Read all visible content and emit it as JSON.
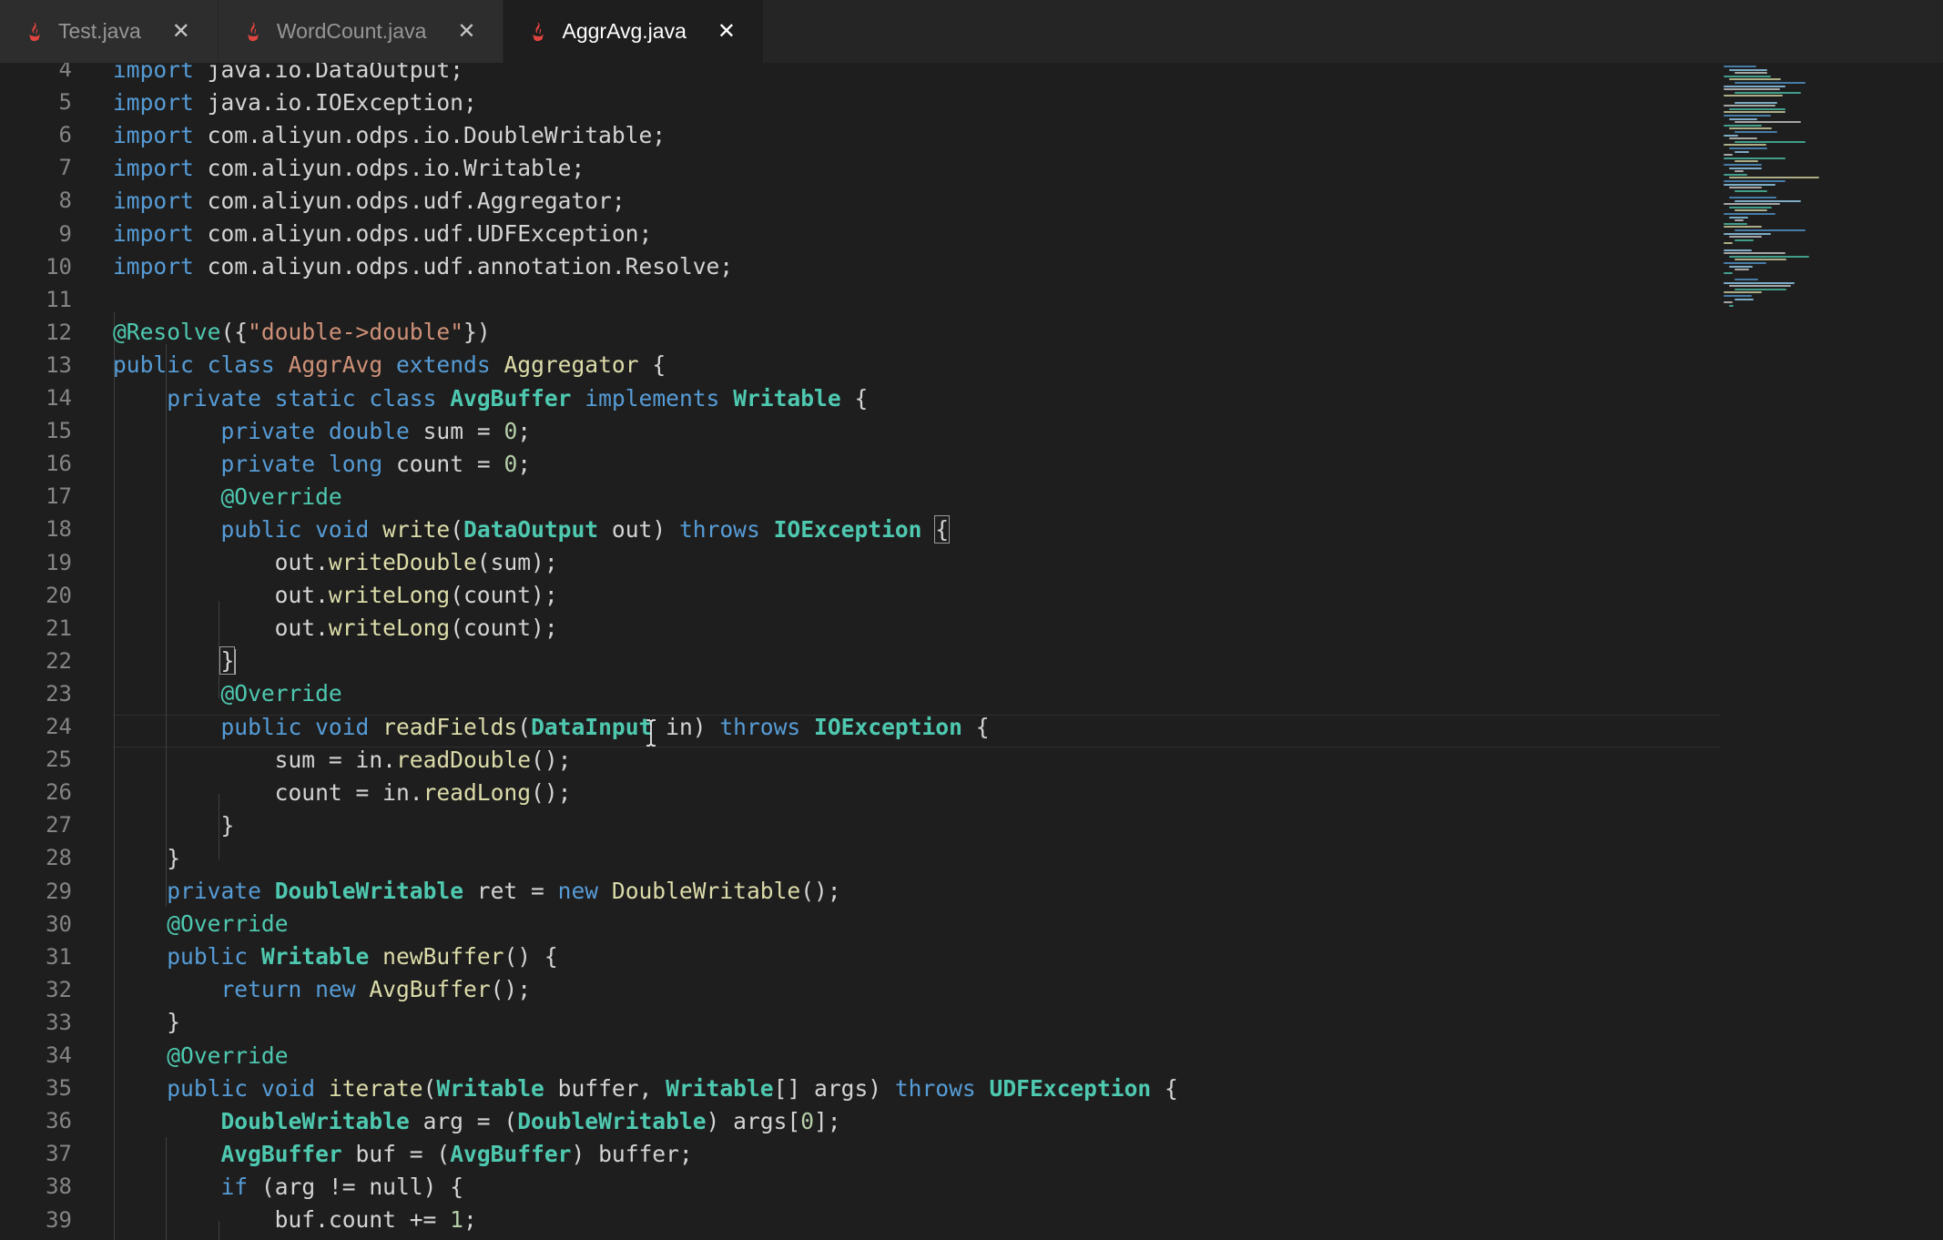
{
  "tabs": [
    {
      "label": "Test.java",
      "active": false
    },
    {
      "label": "WordCount.java",
      "active": false
    },
    {
      "label": "AggrAvg.java",
      "active": true
    }
  ],
  "colors": {
    "background": "#1e1e1e",
    "tabbar": "#252526",
    "keyword": "#569cd6",
    "type": "#4ec9b0",
    "function": "#dcdcaa",
    "string": "#ce9178",
    "number": "#b5cea8",
    "line_number": "#858585",
    "java_icon": "#e0443e"
  },
  "icons": {
    "tab_file": "java-file-icon",
    "tab_close": "close-icon",
    "mouse": "text-cursor-ibeam-icon"
  },
  "editor": {
    "current_line": 22,
    "lines": [
      {
        "n": "4",
        "tokens": [
          [
            "kw",
            "import"
          ],
          [
            "p",
            " java.io.DataOutput;"
          ]
        ]
      },
      {
        "n": "5",
        "tokens": [
          [
            "kw",
            "import"
          ],
          [
            "p",
            " java.io.IOException;"
          ]
        ]
      },
      {
        "n": "6",
        "tokens": [
          [
            "kw",
            "import"
          ],
          [
            "p",
            " com.aliyun.odps.io.DoubleWritable;"
          ]
        ]
      },
      {
        "n": "7",
        "tokens": [
          [
            "kw",
            "import"
          ],
          [
            "p",
            " com.aliyun.odps.io.Writable;"
          ]
        ]
      },
      {
        "n": "8",
        "tokens": [
          [
            "kw",
            "import"
          ],
          [
            "p",
            " com.aliyun.odps.udf.Aggregator;"
          ]
        ]
      },
      {
        "n": "9",
        "tokens": [
          [
            "kw",
            "import"
          ],
          [
            "p",
            " com.aliyun.odps.udf.UDFException;"
          ]
        ]
      },
      {
        "n": "10",
        "tokens": [
          [
            "kw",
            "import"
          ],
          [
            "p",
            " com.aliyun.odps.udf.annotation.Resolve;"
          ]
        ]
      },
      {
        "n": "11",
        "tokens": []
      },
      {
        "n": "12",
        "tokens": [
          [
            "ann",
            "@Resolve"
          ],
          [
            "p",
            "({"
          ],
          [
            "str",
            "\"double->double\""
          ],
          [
            "p",
            "})"
          ]
        ]
      },
      {
        "n": "13",
        "tokens": [
          [
            "kw",
            "public"
          ],
          [
            "p",
            " "
          ],
          [
            "kw",
            "class"
          ],
          [
            "p",
            " "
          ],
          [
            "str",
            "AggrAvg"
          ],
          [
            "p",
            " "
          ],
          [
            "kw",
            "extends"
          ],
          [
            "p",
            " "
          ],
          [
            "fn",
            "Aggregator"
          ],
          [
            "p",
            " {"
          ]
        ]
      },
      {
        "n": "14",
        "tokens": [
          [
            "p",
            "    "
          ],
          [
            "kw",
            "private"
          ],
          [
            "p",
            " "
          ],
          [
            "kw",
            "static"
          ],
          [
            "p",
            " "
          ],
          [
            "kw",
            "class"
          ],
          [
            "p",
            " "
          ],
          [
            "type",
            "AvgBuffer"
          ],
          [
            "p",
            " "
          ],
          [
            "kw",
            "implements"
          ],
          [
            "p",
            " "
          ],
          [
            "type",
            "Writable"
          ],
          [
            "p",
            " {"
          ]
        ]
      },
      {
        "n": "15",
        "tokens": [
          [
            "p",
            "        "
          ],
          [
            "kw",
            "private"
          ],
          [
            "p",
            " "
          ],
          [
            "kw",
            "double"
          ],
          [
            "p",
            " sum = "
          ],
          [
            "num",
            "0"
          ],
          [
            "p",
            ";"
          ]
        ]
      },
      {
        "n": "16",
        "tokens": [
          [
            "p",
            "        "
          ],
          [
            "kw",
            "private"
          ],
          [
            "p",
            " "
          ],
          [
            "kw",
            "long"
          ],
          [
            "p",
            " count = "
          ],
          [
            "num",
            "0"
          ],
          [
            "p",
            ";"
          ]
        ]
      },
      {
        "n": "17",
        "tokens": [
          [
            "p",
            "        "
          ],
          [
            "ann",
            "@Override"
          ]
        ]
      },
      {
        "n": "18",
        "tokens": [
          [
            "p",
            "        "
          ],
          [
            "kw",
            "public"
          ],
          [
            "p",
            " "
          ],
          [
            "kw",
            "void"
          ],
          [
            "p",
            " "
          ],
          [
            "fn",
            "write"
          ],
          [
            "p",
            "("
          ],
          [
            "type",
            "DataOutput"
          ],
          [
            "p",
            " out) "
          ],
          [
            "kw",
            "throws"
          ],
          [
            "p",
            " "
          ],
          [
            "type",
            "IOException"
          ],
          [
            "p",
            " "
          ],
          [
            "box",
            "{"
          ]
        ]
      },
      {
        "n": "19",
        "tokens": [
          [
            "p",
            "            out."
          ],
          [
            "fn",
            "writeDouble"
          ],
          [
            "p",
            "(sum);"
          ]
        ]
      },
      {
        "n": "20",
        "tokens": [
          [
            "p",
            "            out."
          ],
          [
            "fn",
            "writeLong"
          ],
          [
            "p",
            "(count);"
          ]
        ]
      },
      {
        "n": "21",
        "tokens": [
          [
            "p",
            "            out."
          ],
          [
            "fn",
            "writeLong"
          ],
          [
            "p",
            "(count);"
          ]
        ]
      },
      {
        "n": "22",
        "tokens": [
          [
            "p",
            "        "
          ],
          [
            "box",
            "}"
          ],
          [
            "caret",
            ""
          ]
        ]
      },
      {
        "n": "23",
        "tokens": [
          [
            "p",
            "        "
          ],
          [
            "ann",
            "@Override"
          ]
        ]
      },
      {
        "n": "24",
        "tokens": [
          [
            "p",
            "        "
          ],
          [
            "kw",
            "public"
          ],
          [
            "p",
            " "
          ],
          [
            "kw",
            "void"
          ],
          [
            "p",
            " "
          ],
          [
            "fn",
            "readFields"
          ],
          [
            "p",
            "("
          ],
          [
            "type",
            "DataInput"
          ],
          [
            "p",
            " in) "
          ],
          [
            "kw",
            "throws"
          ],
          [
            "p",
            " "
          ],
          [
            "type",
            "IOException"
          ],
          [
            "p",
            " {"
          ]
        ]
      },
      {
        "n": "25",
        "tokens": [
          [
            "p",
            "            sum = in."
          ],
          [
            "fn",
            "readDouble"
          ],
          [
            "p",
            "();"
          ]
        ]
      },
      {
        "n": "26",
        "tokens": [
          [
            "p",
            "            count = in."
          ],
          [
            "fn",
            "readLong"
          ],
          [
            "p",
            "();"
          ]
        ]
      },
      {
        "n": "27",
        "tokens": [
          [
            "p",
            "        }"
          ]
        ]
      },
      {
        "n": "28",
        "tokens": [
          [
            "p",
            "    }"
          ]
        ]
      },
      {
        "n": "29",
        "tokens": [
          [
            "p",
            "    "
          ],
          [
            "kw",
            "private"
          ],
          [
            "p",
            " "
          ],
          [
            "type",
            "DoubleWritable"
          ],
          [
            "p",
            " ret = "
          ],
          [
            "kw",
            "new"
          ],
          [
            "p",
            " "
          ],
          [
            "fn",
            "DoubleWritable"
          ],
          [
            "p",
            "();"
          ]
        ]
      },
      {
        "n": "30",
        "tokens": [
          [
            "p",
            "    "
          ],
          [
            "ann",
            "@Override"
          ]
        ]
      },
      {
        "n": "31",
        "tokens": [
          [
            "p",
            "    "
          ],
          [
            "kw",
            "public"
          ],
          [
            "p",
            " "
          ],
          [
            "type",
            "Writable"
          ],
          [
            "p",
            " "
          ],
          [
            "fn",
            "newBuffer"
          ],
          [
            "p",
            "() {"
          ]
        ]
      },
      {
        "n": "32",
        "tokens": [
          [
            "p",
            "        "
          ],
          [
            "kw",
            "return"
          ],
          [
            "p",
            " "
          ],
          [
            "kw",
            "new"
          ],
          [
            "p",
            " "
          ],
          [
            "fn",
            "AvgBuffer"
          ],
          [
            "p",
            "();"
          ]
        ]
      },
      {
        "n": "33",
        "tokens": [
          [
            "p",
            "    }"
          ]
        ]
      },
      {
        "n": "34",
        "tokens": [
          [
            "p",
            "    "
          ],
          [
            "ann",
            "@Override"
          ]
        ]
      },
      {
        "n": "35",
        "tokens": [
          [
            "p",
            "    "
          ],
          [
            "kw",
            "public"
          ],
          [
            "p",
            " "
          ],
          [
            "kw",
            "void"
          ],
          [
            "p",
            " "
          ],
          [
            "fn",
            "iterate"
          ],
          [
            "p",
            "("
          ],
          [
            "type",
            "Writable"
          ],
          [
            "p",
            " buffer, "
          ],
          [
            "type",
            "Writable"
          ],
          [
            "p",
            "[] args) "
          ],
          [
            "kw",
            "throws"
          ],
          [
            "p",
            " "
          ],
          [
            "type",
            "UDFException"
          ],
          [
            "p",
            " {"
          ]
        ]
      },
      {
        "n": "36",
        "tokens": [
          [
            "p",
            "        "
          ],
          [
            "type",
            "DoubleWritable"
          ],
          [
            "p",
            " arg = ("
          ],
          [
            "type",
            "DoubleWritable"
          ],
          [
            "p",
            ") args["
          ],
          [
            "num",
            "0"
          ],
          [
            "p",
            "];"
          ]
        ]
      },
      {
        "n": "37",
        "tokens": [
          [
            "p",
            "        "
          ],
          [
            "type",
            "AvgBuffer"
          ],
          [
            "p",
            " buf = ("
          ],
          [
            "type",
            "AvgBuffer"
          ],
          [
            "p",
            ") buffer;"
          ]
        ]
      },
      {
        "n": "38",
        "tokens": [
          [
            "p",
            "        "
          ],
          [
            "kw",
            "if"
          ],
          [
            "p",
            " (arg != null) {"
          ]
        ]
      },
      {
        "n": "39",
        "tokens": [
          [
            "p",
            "            buf.count += "
          ],
          [
            "num",
            "1"
          ],
          [
            "p",
            ";"
          ]
        ]
      }
    ]
  }
}
